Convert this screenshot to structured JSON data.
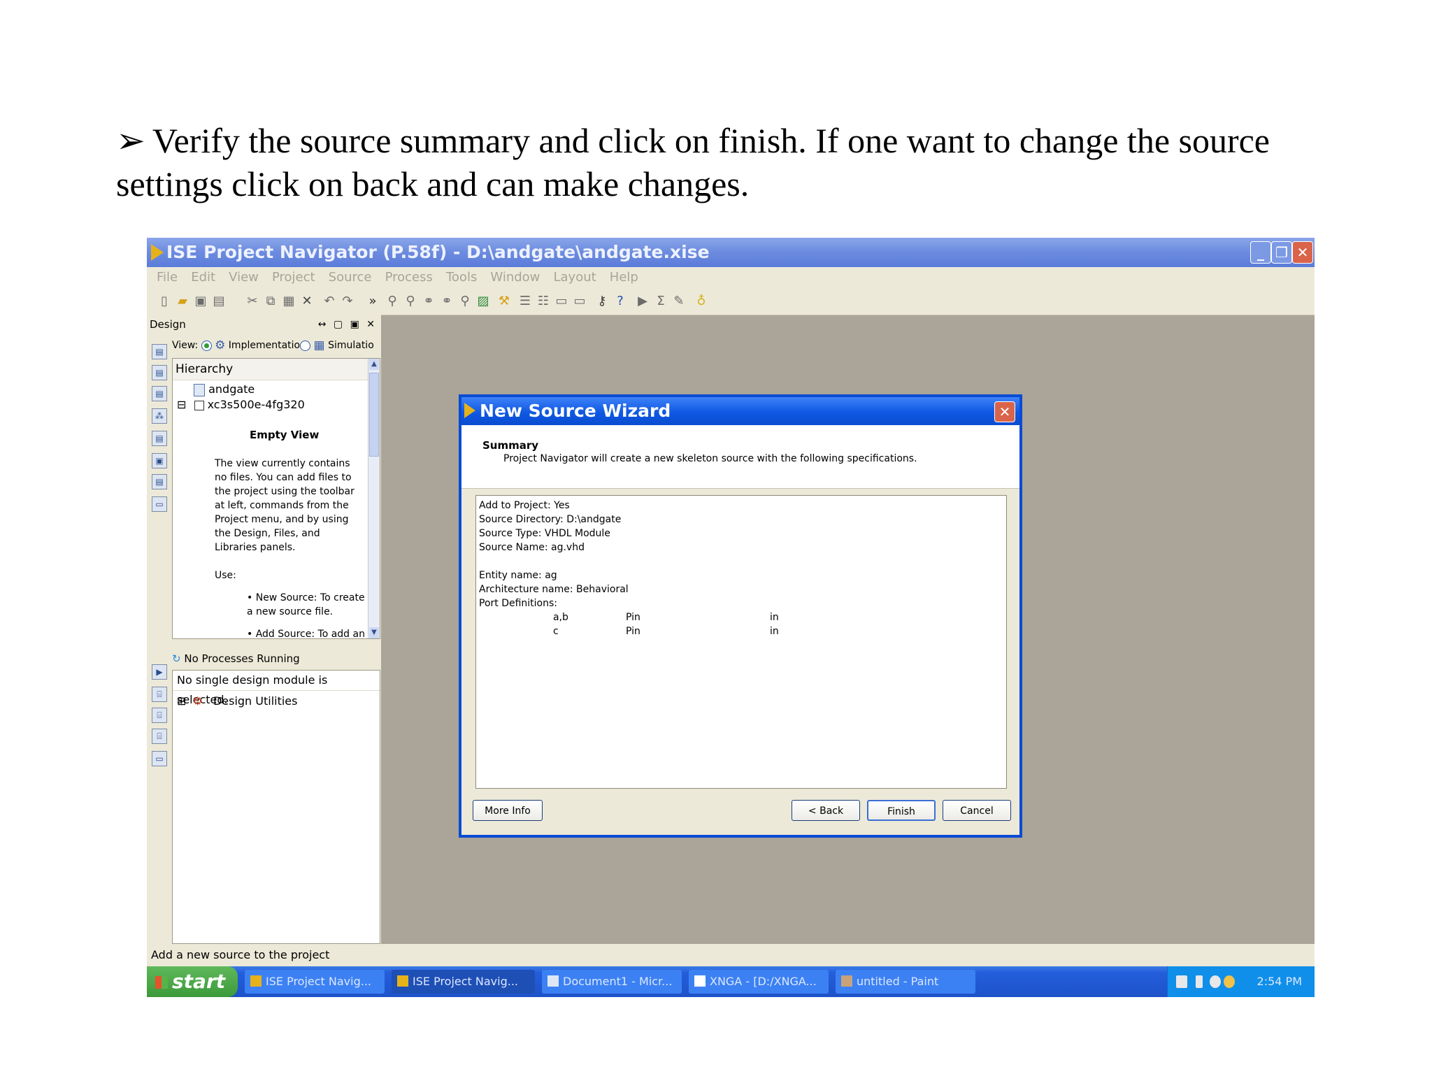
{
  "caption": {
    "bullet": "➢",
    "text": "Verify the source summary and click on finish. If one want to change the source settings click on back and can make changes."
  },
  "window": {
    "title": "ISE Project Navigator (P.58f) - D:\\andgate\\andgate.xise",
    "controls": [
      "_",
      "❐",
      "✕"
    ]
  },
  "menu": [
    "File",
    "Edit",
    "View",
    "Project",
    "Source",
    "Process",
    "Tools",
    "Window",
    "Layout",
    "Help"
  ],
  "design_panel": {
    "title": "Design",
    "controls": "↔ ▢ ▣ ✕",
    "view_label": "View:",
    "view_implementation": "Implementatio",
    "view_simulation": "Simulatio",
    "hierarchy_label": "Hierarchy",
    "tree": [
      {
        "label": "andgate",
        "expander": "",
        "icon": "project-icon"
      },
      {
        "label": "xc3s500e-4fg320",
        "expander": "⊟",
        "icon": "chip-icon"
      }
    ],
    "empty_title": "Empty View",
    "empty_text": "The view currently contains no files. You can add files to the project using the toolbar at left, commands from the Project menu, and by using the Design, Files, and Libraries panels.",
    "use_label": "Use:",
    "bullets": [
      "New Source: To create a new source file.",
      "Add Source: To add an"
    ]
  },
  "processes": {
    "status": "No Processes Running",
    "message": "No single design module is selected.",
    "utility": "Design Utilities"
  },
  "status_bar": "Add a new source to the project",
  "dialog": {
    "title": "New Source Wizard",
    "close": "✕",
    "summary_heading": "Summary",
    "summary_subheading": "Project Navigator will create a new skeleton source with the following specifications.",
    "lines": [
      "Add to Project: Yes",
      "Source Directory: D:\\andgate",
      "Source Type: VHDL Module",
      "Source Name: ag.vhd",
      "",
      "Entity name: ag",
      "Architecture name: Behavioral",
      "Port Definitions:"
    ],
    "ports": [
      {
        "name": "a,b",
        "type": "Pin",
        "dir": "in"
      },
      {
        "name": "c",
        "type": "Pin",
        "dir": "in"
      }
    ],
    "buttons": {
      "more_info": "More Info",
      "back": "< Back",
      "finish": "Finish",
      "cancel": "Cancel"
    }
  },
  "taskbar": {
    "start": "start",
    "tasks": [
      "ISE Project Navig...",
      "ISE Project Navig...",
      "Document1 - Micr...",
      "XNGA - [D:/XNGA...",
      "untitled - Paint"
    ],
    "clock": "2:54 PM"
  },
  "colors": {
    "titlebar": "#6e8de0",
    "dialog_border": "#0a4bd4",
    "workspace": "#aaa598",
    "chrome": "#ece9d8",
    "taskbar": "#245edb",
    "start_button": "#3c9a39"
  }
}
